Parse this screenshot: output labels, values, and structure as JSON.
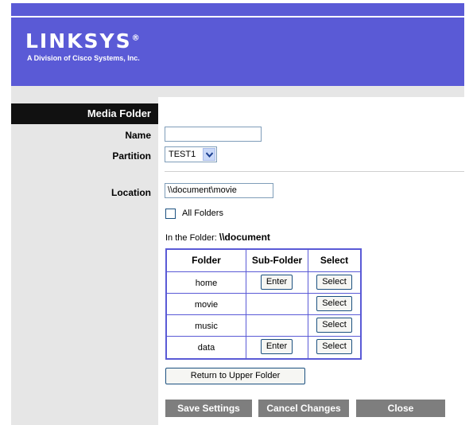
{
  "brand": {
    "logo_text": "LINKSYS",
    "registered": "®",
    "tagline": "A Division of Cisco Systems, Inc."
  },
  "section_title": "Media Folder",
  "form": {
    "name_label": "Name",
    "name_value": "",
    "partition_label": "Partition",
    "partition_value": "TEST1",
    "location_label": "Location",
    "location_value": "\\\\document\\movie",
    "all_folders_label": "All Folders",
    "all_folders_checked": false
  },
  "folder_info": {
    "prefix": "In the Folder:",
    "path": "\\\\document"
  },
  "table": {
    "headers": [
      "Folder",
      "Sub-Folder",
      "Select"
    ],
    "rows": [
      {
        "folder": "home",
        "subfolder_button": "Enter",
        "select_button": "Select"
      },
      {
        "folder": "movie",
        "subfolder_button": "",
        "select_button": "Select"
      },
      {
        "folder": "music",
        "subfolder_button": "",
        "select_button": "Select"
      },
      {
        "folder": "data",
        "subfolder_button": "Enter",
        "select_button": "Select"
      }
    ]
  },
  "return_button": "Return to Upper Folder",
  "actions": {
    "save": "Save Settings",
    "cancel": "Cancel Changes",
    "close": "Close"
  },
  "colors": {
    "brand_blue": "#5a5ad6",
    "button_gray": "#7e7e7e",
    "panel_gray": "#e6e6e6"
  }
}
